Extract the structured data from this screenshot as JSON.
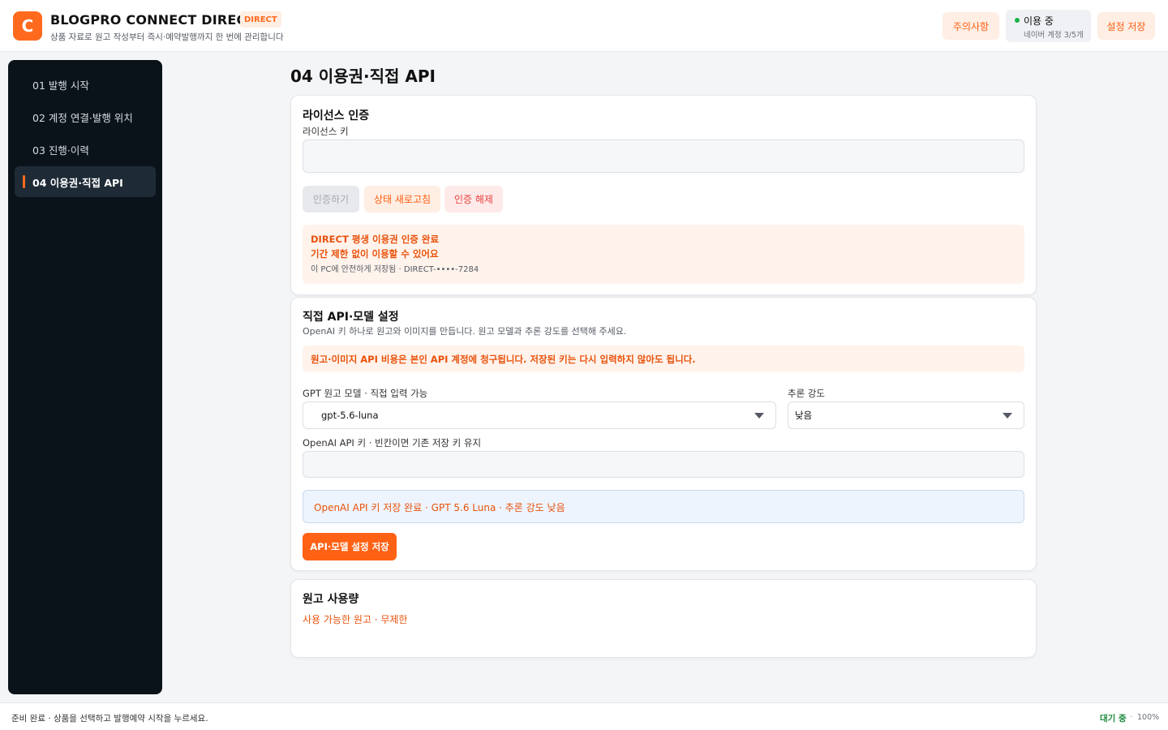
{
  "header": {
    "logo_letter": "C",
    "title": "BLOGPRO CONNECT DIRECT",
    "badge": "DIRECT",
    "subtitle": "상품 자료로 원고 작성부터 즉시·예약발행까지 한 번에 관리합니다",
    "caution_label": "주의사항",
    "status_label": "이용 중",
    "status_sub": "네이버 계정 3/5개",
    "save_settings_label": "설정 저장"
  },
  "sidebar": {
    "items": [
      {
        "label": "01  발행 시작",
        "active": false
      },
      {
        "label": "02  계정 연결·발행 위치",
        "active": false
      },
      {
        "label": "03  진행·이력",
        "active": false
      },
      {
        "label": "04  이용권·직접 API",
        "active": true
      }
    ]
  },
  "main": {
    "page_title": "04  이용권·직접 API",
    "license": {
      "title": "라이선스 인증",
      "key_label": "라이선스 키",
      "key_value": "",
      "auth_button": "인증하기",
      "refresh_button": "상태 새로고침",
      "release_button": "인증 해제",
      "notice_line1": "DIRECT 평생 이용권 인증 완료",
      "notice_line2": "기간 제한 없이 이용할 수 있어요",
      "notice_line3": "이 PC에 안전하게 저장됨 · DIRECT-••••-7284"
    },
    "api": {
      "title": "직접 API·모델 설정",
      "description": "OpenAI 키 하나로 원고와 이미지를 만듭니다. 원고 모델과 추론 강도를 선택해 주세요.",
      "warning": "원고·이미지 API 비용은 본인 API 계정에 청구됩니다. 저장된 키는 다시 입력하지 않아도 됩니다.",
      "model_label": "GPT 원고 모델 · 직접 입력 가능",
      "model_value": "gpt-5.6-luna",
      "reasoning_label": "추론 강도",
      "reasoning_value": "낮음",
      "key_label": "OpenAI API 키 · 빈칸이면 기존 저장 키 유지",
      "key_value": "",
      "saved_message": "OpenAI API 키 저장 완료 · GPT 5.6 Luna · 추론 강도 낮음",
      "save_button": "API·모델 설정 저장"
    },
    "usage": {
      "title": "원고 사용량",
      "text": "사용 가능한 원고 · 무제한"
    }
  },
  "footer": {
    "message": "준비 완료 · 상품을 선택하고 발행예약 시작을 누르세요.",
    "state": "대기 중",
    "separator": "·",
    "zoom": "100%"
  },
  "colors": {
    "accent": "#ff6a1f",
    "sidebar_bg": "#0b131a",
    "success": "#19b34a"
  }
}
